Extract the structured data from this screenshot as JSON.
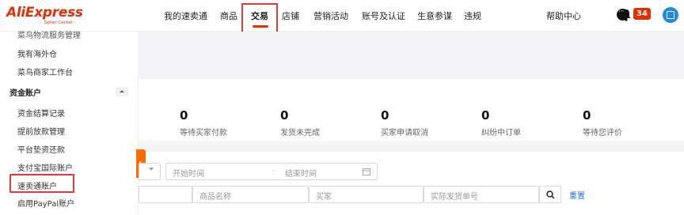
{
  "header": {
    "logo_brand": "AliExpress",
    "logo_sub": "Seller Center",
    "nav": [
      "我的速卖通",
      "商品",
      "交易",
      "店铺",
      "营销活动",
      "账号及认证",
      "生意参谋",
      "违规"
    ],
    "active_nav": "交易",
    "help": "帮助中心",
    "notification_count": "34",
    "icons": [
      "chat-icon",
      "bell-icon",
      "store-icon"
    ],
    "accent_color": "#e62e04"
  },
  "sidebar": {
    "items_top": [
      "菜鸟物流服务管理",
      "我有海外仓",
      "菜鸟商家工作台"
    ],
    "group": "资金账户",
    "items": [
      "资金结算记录",
      "提前放款管理",
      "平台垫资还款",
      "支付宝国际账户",
      "速卖通账户",
      "启用PayPal账户"
    ],
    "highlighted": "速卖通账户"
  },
  "stats": [
    {
      "value": "0",
      "label": "等待买家付款"
    },
    {
      "value": "0",
      "label": "发货未完成"
    },
    {
      "value": "0",
      "label": "买家申请取消"
    },
    {
      "value": "0",
      "label": "纠纷中订单"
    },
    {
      "value": "0",
      "label": "等待您评价"
    }
  ],
  "filters": {
    "start_time": "开始时间",
    "end_time": "结束时间",
    "product_name": "商品名称",
    "buyer": "买家",
    "tracking": "实际发货单号",
    "reset": "重置"
  }
}
